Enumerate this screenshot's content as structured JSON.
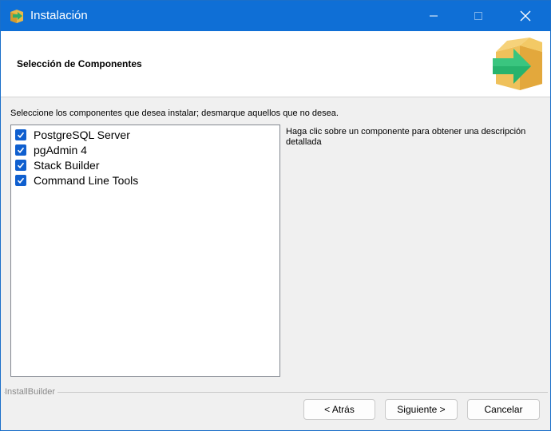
{
  "window": {
    "title": "Instalación",
    "accent": "#0f6fd6"
  },
  "header": {
    "title": "Selección de Componentes",
    "icon": "installer-box-arrow-icon"
  },
  "instructions": "Seleccione los componentes que desea instalar; desmarque aquellos que no desea.",
  "components": [
    {
      "label": "PostgreSQL Server",
      "checked": true
    },
    {
      "label": "pgAdmin 4",
      "checked": true
    },
    {
      "label": "Stack Builder",
      "checked": true
    },
    {
      "label": "Command Line Tools",
      "checked": true
    }
  ],
  "description": "Haga clic sobre un componente para obtener una descripción detallada",
  "footer": {
    "brand": "InstallBuilder"
  },
  "buttons": {
    "back": "< Atrás",
    "next": "Siguiente >",
    "cancel": "Cancelar"
  }
}
